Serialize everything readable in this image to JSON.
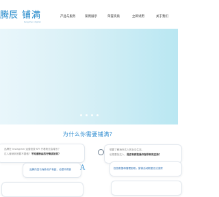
{
  "header": {
    "logo_cut": "腾辰",
    "logo_main": "铺满",
    "logo_sub": "tengchen digital",
    "nav": [
      "产品与服务",
      "案例展示",
      "荣誉资质",
      "立即试用",
      "关于我们"
    ]
  },
  "carousel": {
    "slide_count": 4,
    "active_index": 0
  },
  "section": {
    "title": "为什么你需要铺满？"
  },
  "cards": [
    {
      "line1": "品牌在 Instagram 运营投放 KPI 只看粉丝会增长？",
      "line2_plain": "达人营销到底要不要做？",
      "line2_bold": "不知道粉丝的行情该如何？"
    },
    {
      "line1": "想要了解海外达人的社交生态，",
      "line2_plain": "也想要找达人，",
      "line2_bold": "是否有获取操作指导有效支持？"
    },
    {
      "line1": "品牌内容与海外用户有距，也很不得到"
    },
    {
      "line1": "投放数据和管理困难，营销活动数据无法追踪"
    }
  ],
  "colors": {
    "brand_blue": "#1e86c9",
    "title_blue": "#2d8bd0"
  }
}
